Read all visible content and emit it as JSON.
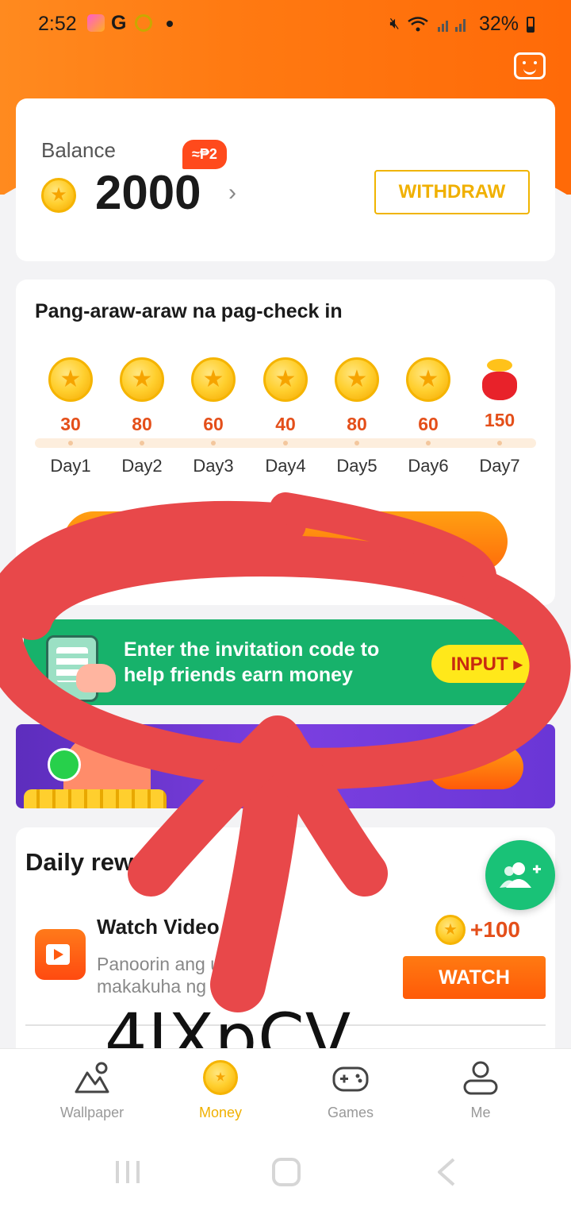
{
  "status_bar": {
    "time": "2:52",
    "battery": "32%"
  },
  "balance": {
    "label": "Balance",
    "value": "2000",
    "peso_badge": "≈₱2",
    "withdraw_label": "WITHDRAW"
  },
  "checkin": {
    "title": "Pang-araw-araw na pag-check in",
    "days": [
      {
        "amount": "30",
        "label": "Day1"
      },
      {
        "amount": "80",
        "label": "Day2"
      },
      {
        "amount": "60",
        "label": "Day3"
      },
      {
        "amount": "40",
        "label": "Day4"
      },
      {
        "amount": "80",
        "label": "Day5"
      },
      {
        "amount": "60",
        "label": "Day6"
      },
      {
        "amount": "150",
        "label": "Day7"
      }
    ]
  },
  "invite": {
    "text": "Enter the invitation code to help friends earn money",
    "button_label": "INPUT ▸"
  },
  "daily_rewards": {
    "title": "Daily rew",
    "task_title": "Watch Video",
    "task_desc": "Panoorin ang   upang makakuha ng   barya",
    "reward": "+100",
    "watch_label": "WATCH"
  },
  "annotation": {
    "handwritten_code": "4IXpCV",
    "color": "#e8484a"
  },
  "bottom_nav": {
    "items": [
      {
        "label": "Wallpaper",
        "icon": "wallpaper-icon"
      },
      {
        "label": "Money",
        "icon": "coin-icon"
      },
      {
        "label": "Games",
        "icon": "gamepad-icon"
      },
      {
        "label": "Me",
        "icon": "person-icon"
      }
    ],
    "active_index": 1
  },
  "colors": {
    "brand_orange": "#ff7a12",
    "accent_gold": "#f0b000",
    "invite_green": "#17b26b",
    "fab_green": "#19c277"
  }
}
